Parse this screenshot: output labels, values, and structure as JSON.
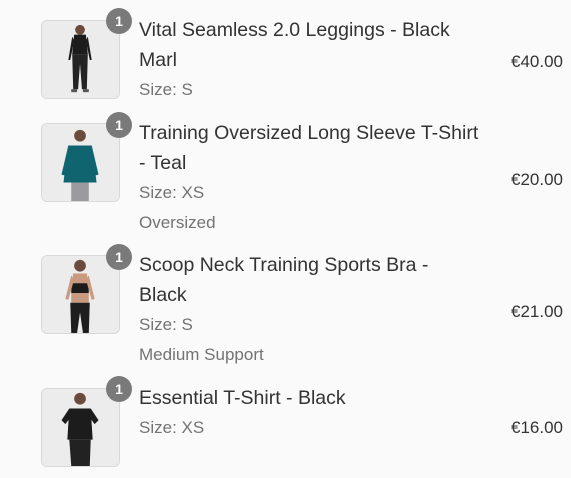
{
  "items": [
    {
      "quantity": "1",
      "name": "Vital Seamless 2.0 Leggings - Black Marl",
      "size": "Size: S",
      "extra": "",
      "price": "€40.00",
      "image_desc": "leggings-product-image"
    },
    {
      "quantity": "1",
      "name": "Training Oversized Long Sleeve T-Shirt - Teal",
      "size": "Size: XS",
      "extra": "Oversized",
      "price": "€20.00",
      "image_desc": "long-sleeve-product-image"
    },
    {
      "quantity": "1",
      "name": "Scoop Neck Training Sports Bra - Black",
      "size": "Size: S",
      "extra": "Medium Support",
      "price": "€21.00",
      "image_desc": "sports-bra-product-image"
    },
    {
      "quantity": "1",
      "name": "Essential T-Shirt - Black",
      "size": "Size: XS",
      "extra": "",
      "price": "€16.00",
      "image_desc": "tshirt-product-image"
    }
  ]
}
